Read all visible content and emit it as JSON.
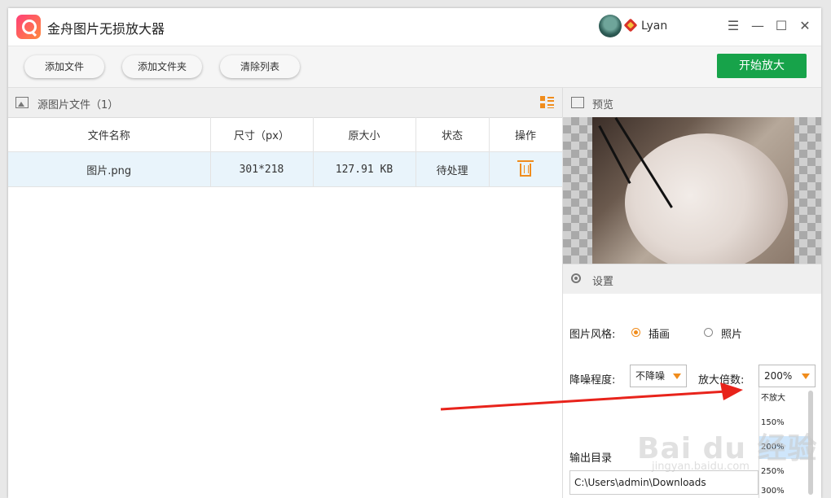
{
  "app": {
    "title": "金舟图片无损放大器",
    "user": "Lyan"
  },
  "toolbar": {
    "add_file": "添加文件",
    "add_folder": "添加文件夹",
    "clear_list": "清除列表",
    "start": "开始放大"
  },
  "file_panel": {
    "title": "源图片文件（1）",
    "columns": [
      "文件名称",
      "尺寸（px）",
      "原大小",
      "状态",
      "操作"
    ],
    "rows": [
      {
        "name": "图片.png",
        "size": "301*218",
        "filesize": "127.91 KB",
        "status": "待处理"
      }
    ]
  },
  "preview": {
    "title": "预览"
  },
  "settings": {
    "title": "设置",
    "style_label": "图片风格:",
    "style_options": [
      "插画",
      "照片"
    ],
    "style_selected": "插画",
    "denoise_label": "降噪程度:",
    "denoise_value": "不降噪",
    "scale_label": "放大倍数:",
    "scale_value": "200%",
    "scale_options": [
      "不放大",
      "150%",
      "200%",
      "250%",
      "300%"
    ],
    "output_label": "输出目录",
    "output_path": "C:\\Users\\admin\\Downloads"
  },
  "watermark": {
    "text": "Bai du 经验",
    "sub": "jingyan.baidu.com"
  },
  "colors": {
    "accent": "#f08c1c",
    "start_button": "#17a34a",
    "annotation_arrow": "#e8231b"
  }
}
